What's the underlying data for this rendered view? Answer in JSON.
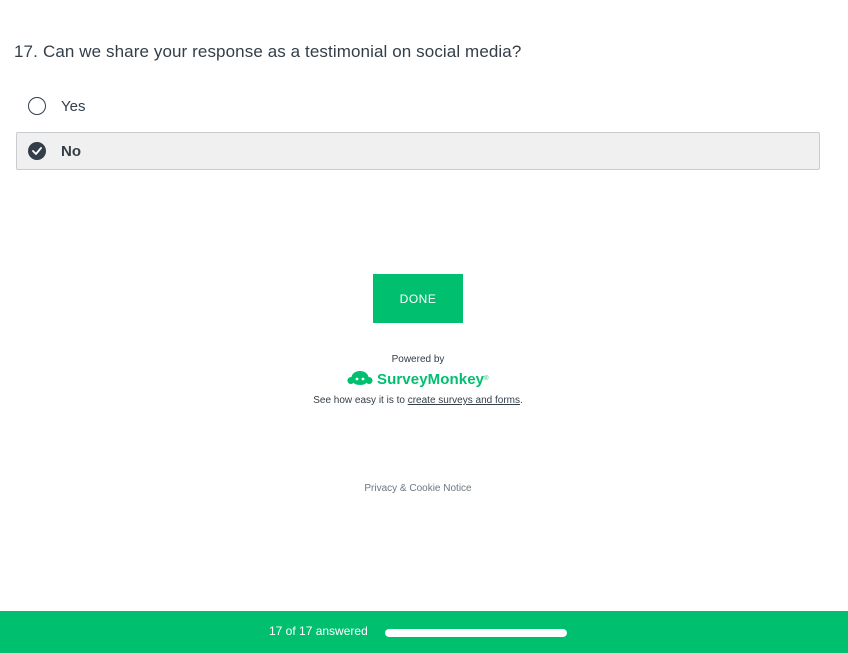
{
  "question": {
    "number": "17.",
    "text": "Can we share your response as a testimonial on social media?",
    "options": [
      {
        "label": "Yes",
        "selected": false
      },
      {
        "label": "No",
        "selected": true
      }
    ]
  },
  "done_button": {
    "label": "DONE"
  },
  "branding": {
    "powered_by": "Powered by",
    "brand_name": "SurveyMonkey",
    "brand_mark": "®",
    "tagline_prefix": "See how easy it is to",
    "tagline_link": "create surveys and forms",
    "tagline_suffix": "."
  },
  "privacy": {
    "label": "Privacy & Cookie Notice"
  },
  "footer": {
    "progress_text": "17 of 17 answered",
    "progress_fraction": 1.0
  },
  "colors": {
    "accent": "#00bf6f",
    "text": "#333e48",
    "selected_bg": "#f0f0f0"
  }
}
